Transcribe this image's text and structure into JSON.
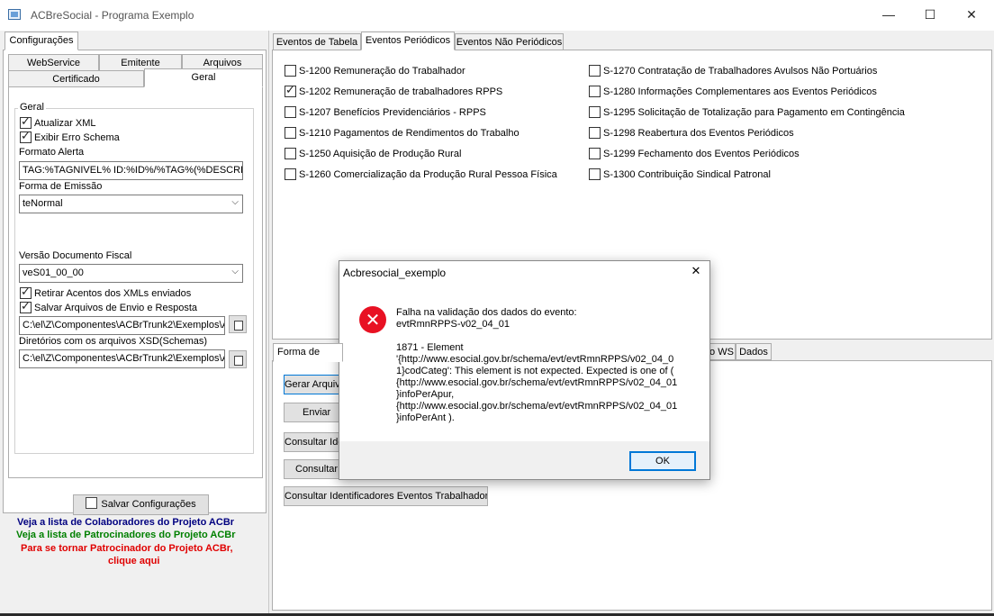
{
  "window": {
    "title": "ACBreSocial - Programa Exemplo",
    "minimize": "—",
    "maximize": "☐",
    "close": "✕"
  },
  "left": {
    "config_tab": "Configurações",
    "tabs_row1": [
      "WebService",
      "Emitente",
      "Arquivos"
    ],
    "tabs_row2": [
      "Certificado",
      "Geral"
    ],
    "group_geral": "Geral",
    "atualizar_xml": "Atualizar XML",
    "exibir_erro": "Exibir Erro Schema",
    "formato_alerta_label": "Formato Alerta",
    "formato_alerta_value": "TAG:%TAGNIVEL% ID:%ID%/%TAG%(%DESCRI",
    "forma_emissao_label": "Forma de Emissão",
    "forma_emissao_value": "teNormal",
    "versao_label": "Versão Documento Fiscal",
    "versao_value": "veS01_00_00",
    "retirar_acentos": "Retirar Acentos dos XMLs enviados",
    "salvar_arquivos": "Salvar Arquivos de Envio e Resposta",
    "path1": "C:\\el\\Z\\Componentes\\ACBrTrunk2\\Exemplos\\A",
    "xsd_label": "Diretórios com os arquivos XSD(Schemas)",
    "path2": "C:\\el\\Z\\Componentes\\ACBrTrunk2\\Exemplos\\A",
    "save_button": "Salvar Configurações",
    "link_colab": "Veja a lista de Colaboradores do Projeto ACBr",
    "link_patroc": "Veja a lista de Patrocinadores do Projeto ACBr",
    "link_tornar1": "Para se tornar Patrocinador do Projeto ACBr,",
    "link_tornar2": "clique aqui",
    "colors": {
      "colab": "#000080",
      "patroc": "#008000",
      "tornar": "#e00000"
    }
  },
  "right": {
    "tabs": [
      "Eventos de Tabela",
      "Eventos Periódicos",
      "Eventos Não Periódicos"
    ],
    "events_left": [
      {
        "label": "S-1200 Remuneração do Trabalhador",
        "checked": false
      },
      {
        "label": "S-1202 Remuneração de trabalhadores RPPS",
        "checked": true
      },
      {
        "label": "S-1207 Benefícios  Previdenciários - RPPS",
        "checked": false
      },
      {
        "label": "S-1210 Pagamentos de Rendimentos do Trabalho",
        "checked": false
      },
      {
        "label": "S-1250 Aquisição de Produção Rural",
        "checked": false
      },
      {
        "label": "S-1260 Comercialização da Produção Rural Pessoa Física",
        "checked": false
      }
    ],
    "events_right": [
      {
        "label": "S-1270 Contratação de Trabalhadores Avulsos Não Portuários",
        "checked": false
      },
      {
        "label": "S-1280 Informações Complementares aos Eventos Periódicos",
        "checked": false
      },
      {
        "label": "S-1295 Solicitação de Totalização para Pagamento em Contingência",
        "checked": false
      },
      {
        "label": "S-1298 Reabertura dos Eventos Periódicos",
        "checked": false
      },
      {
        "label": "S-1299 Fechamento dos Eventos Periódicos",
        "checked": false
      },
      {
        "label": "S-1300 Contribuição Sindical Patronal",
        "checked": false
      }
    ],
    "bottom_tabs": {
      "first": "Forma de Envio",
      "ws": "o WS",
      "dados": "Dados"
    },
    "buttons": [
      "Gerar Arquivos",
      "Enviar",
      "Consultar Identificadores",
      "Consultar",
      "Consultar Identificadores Eventos Trabalhador"
    ]
  },
  "dialog": {
    "title": "Acbresocial_exemplo",
    "close": "✕",
    "icon": "error-icon",
    "message": "Falha na validação dos dados do evento:\nevtRmnRPPS-v02_04_01\n\n1871 - Element\n'{http://www.esocial.gov.br/schema/evt/evtRmnRPPS/v02_04_0\n1}codCateg': This element is not expected. Expected is one of (\n{http://www.esocial.gov.br/schema/evt/evtRmnRPPS/v02_04_01\n}infoPerApur,\n{http://www.esocial.gov.br/schema/evt/evtRmnRPPS/v02_04_01\n}infoPerAnt ).",
    "ok": "OK"
  }
}
